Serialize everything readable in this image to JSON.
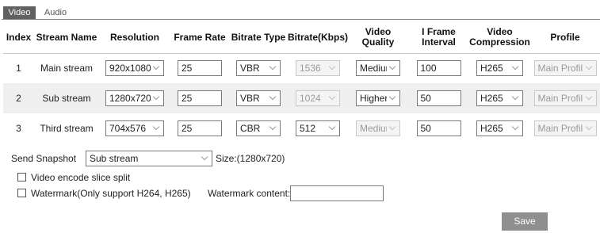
{
  "tabs": [
    {
      "label": "Video",
      "active": true
    },
    {
      "label": "Audio",
      "active": false
    }
  ],
  "table": {
    "headers": {
      "index": "Index",
      "stream_name": "Stream Name",
      "resolution": "Resolution",
      "frame_rate": "Frame Rate",
      "bitrate_type": "Bitrate Type",
      "bitrate": "Bitrate(Kbps)",
      "video_quality": "Video Quality",
      "i_frame_1": "I Frame",
      "i_frame_2": "Interval",
      "compression_1": "Video",
      "compression_2": "Compression",
      "profile": "Profile"
    },
    "rows": [
      {
        "index": "1",
        "name": "Main stream",
        "resolution": "920x1080",
        "frame_rate": "25",
        "bitrate_type": "VBR",
        "bitrate": "1536",
        "quality": "Mediur",
        "i_frame": "100",
        "compression": "H265",
        "profile": "Main Profil"
      },
      {
        "index": "2",
        "name": "Sub stream",
        "resolution": "1280x720",
        "frame_rate": "25",
        "bitrate_type": "VBR",
        "bitrate": "1024",
        "quality": "Higher",
        "i_frame": "50",
        "compression": "H265",
        "profile": "Main Profil"
      },
      {
        "index": "3",
        "name": "Third stream",
        "resolution": "704x576",
        "frame_rate": "25",
        "bitrate_type": "CBR",
        "bitrate": "512",
        "quality": "Mediur",
        "i_frame": "50",
        "compression": "H265",
        "profile": "Main Profil"
      }
    ]
  },
  "snapshot": {
    "label": "Send Snapshot",
    "value": "Sub stream",
    "size_text": "Size:(1280x720)"
  },
  "options": {
    "slice_split_label": "Video encode slice split",
    "slice_split_checked": false,
    "watermark_label": "Watermark(Only support H264, H265)",
    "watermark_checked": false,
    "watermark_content_label": "Watermark content:",
    "watermark_content_value": ""
  },
  "save_label": "Save",
  "colors": {
    "active_tab_bg": "#616161",
    "save_button_bg": "#8f8f8f",
    "even_row_bg": "#efefef"
  }
}
